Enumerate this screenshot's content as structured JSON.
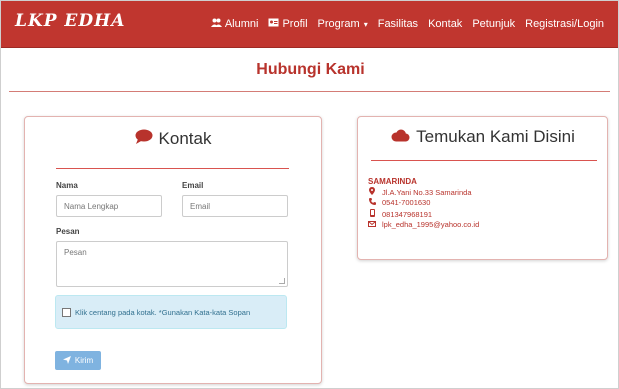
{
  "navbar": {
    "brand": "LKP EDHA",
    "items": [
      {
        "label": "Alumni",
        "icon": "users-icon"
      },
      {
        "label": "Profil",
        "icon": "id-card-icon"
      },
      {
        "label": "Program",
        "icon": "",
        "caret": "▾"
      },
      {
        "label": "Fasilitas",
        "icon": ""
      },
      {
        "label": "Kontak",
        "icon": ""
      },
      {
        "label": "Petunjuk",
        "icon": ""
      },
      {
        "label": "Registrasi/Login",
        "icon": ""
      }
    ]
  },
  "page": {
    "title": "Hubungi Kami"
  },
  "contact_form": {
    "heading": "Kontak",
    "heading_icon": "comment-icon",
    "name_label": "Nama",
    "name_placeholder": "Nama Lengkap",
    "email_label": "Email",
    "email_placeholder": "Email",
    "message_label": "Pesan",
    "message_placeholder": "Pesan",
    "checkbox_text": "Klik centang pada kotak. *Gunakan Kata-kata Sopan",
    "submit_label": "Kirim",
    "submit_icon": "paper-plane-icon"
  },
  "location": {
    "heading": "Temukan Kami Disini",
    "heading_icon": "cloud-icon",
    "city": "SAMARINDA",
    "address": "Jl.A.Yani No.33 Samarinda",
    "phone": "0541-7001630",
    "mobile": "081347968191",
    "email": "lpk_edha_1995@yahoo.co.id"
  },
  "colors": {
    "brand": "#c0362f",
    "accent_text": "#b8332c",
    "notice_bg": "#d9edf7",
    "button": "#7fb3e0"
  }
}
